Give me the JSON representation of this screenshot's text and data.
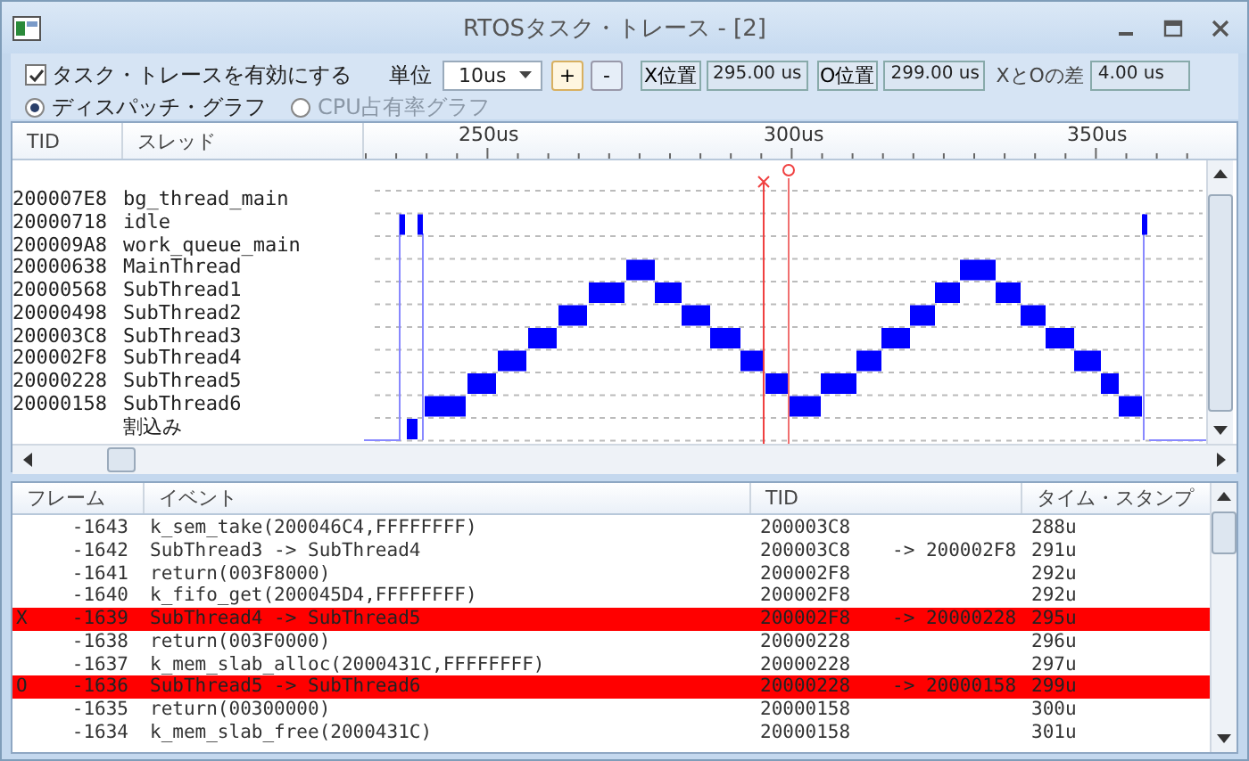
{
  "window": {
    "title": "RTOSタスク・トレース - [2]"
  },
  "toolbar": {
    "enable_trace": {
      "label": "タスク・トレースを有効にする",
      "checked": true
    },
    "unit_label": "単位",
    "unit": "10us",
    "step_buttons": [
      "+",
      "-"
    ],
    "x_position": {
      "button": "X位置",
      "value": "295.00 us"
    },
    "o_position": {
      "button": "O位置",
      "value": "299.00 us"
    },
    "difference": {
      "label": "XとOの差",
      "value": "4.00 us"
    },
    "graph_modes": [
      {
        "label": "ディスパッチ・グラフ",
        "selected": true,
        "disabled": false
      },
      {
        "label": "CPU占有率グラフ",
        "selected": false,
        "disabled": true
      }
    ]
  },
  "trace": {
    "columns": [
      "TID",
      "スレッド"
    ],
    "time_labels": [
      "250us",
      "300us",
      "350us"
    ],
    "lanes": [
      {
        "tid": "200007E8",
        "name": "bg_thread_main"
      },
      {
        "tid": "20000718",
        "name": "idle"
      },
      {
        "tid": "200009A8",
        "name": "work_queue_main"
      },
      {
        "tid": "20000638",
        "name": "MainThread"
      },
      {
        "tid": "20000568",
        "name": "SubThread1"
      },
      {
        "tid": "20000498",
        "name": "SubThread2"
      },
      {
        "tid": "200003C8",
        "name": "SubThread3"
      },
      {
        "tid": "200002F8",
        "name": "SubThread4"
      },
      {
        "tid": "20000228",
        "name": "SubThread5"
      },
      {
        "tid": "20000158",
        "name": "SubThread6"
      },
      {
        "name": "割込み"
      }
    ]
  },
  "events": {
    "columns": [
      "フレーム",
      "イベント",
      "TID",
      "タイム・スタンプ"
    ],
    "rows": [
      {
        "frame": "-1643",
        "event": "k_sem_take(200046C4,FFFFFFFF)",
        "tid": "200003C8",
        "timestamp": "288u",
        "highlighted": false
      },
      {
        "frame": "-1642",
        "event": "SubThread3 -> SubThread4",
        "tid": "200003C8",
        "tid_to": "-> 200002F8",
        "timestamp": "291u",
        "highlighted": false
      },
      {
        "frame": "-1641",
        "event": "return(003F8000)",
        "tid": "200002F8",
        "timestamp": "292u",
        "highlighted": false
      },
      {
        "frame": "-1640",
        "event": "k_fifo_get(200045D4,FFFFFFFF)",
        "tid": "200002F8",
        "timestamp": "292u",
        "highlighted": false
      },
      {
        "marker": "X",
        "frame": "-1639",
        "event": "SubThread4 -> SubThread5",
        "tid": "200002F8",
        "tid_to": "-> 20000228",
        "timestamp": "295u",
        "highlighted": true
      },
      {
        "frame": "-1638",
        "event": "return(003F0000)",
        "tid": "20000228",
        "timestamp": "296u",
        "highlighted": false
      },
      {
        "frame": "-1637",
        "event": "k_mem_slab_alloc(2000431C,FFFFFFFF)",
        "tid": "20000228",
        "timestamp": "297u",
        "highlighted": false
      },
      {
        "marker": "O",
        "frame": "-1636",
        "event": "SubThread5 -> SubThread6",
        "tid": "20000228",
        "tid_to": "-> 20000158",
        "timestamp": "299u",
        "highlighted": true
      },
      {
        "frame": "-1635",
        "event": "return(00300000)",
        "tid": "20000158",
        "timestamp": "300u",
        "highlighted": false
      },
      {
        "frame": "-1634",
        "event": "k_mem_slab_free(2000431C)",
        "tid": "20000158",
        "timestamp": "301u",
        "highlighted": false
      }
    ]
  }
}
